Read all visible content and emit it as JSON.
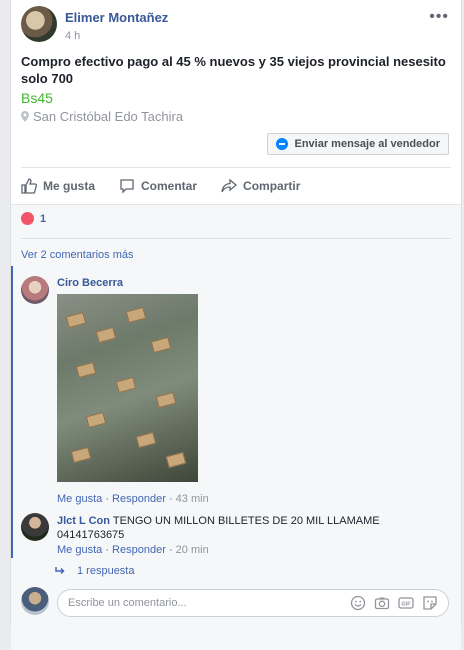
{
  "post": {
    "author": "Elimer Montañez",
    "time": "4 h",
    "more_label": "•••",
    "text": "Compro efectivo pago al 45 % nuevos y 35 viejos provincial nesesito solo 700",
    "price": "Bs45",
    "location": "San Cristóbal Edo Tachira",
    "message_button": "Enviar mensaje al vendedor"
  },
  "actions": {
    "like": "Me gusta",
    "comment": "Comentar",
    "share": "Compartir"
  },
  "reactions": {
    "count": "1"
  },
  "comments": {
    "view_more": "Ver 2 comentarios más",
    "items": [
      {
        "author": "Ciro Becerra",
        "like": "Me gusta",
        "sep": "·",
        "reply": "Responder",
        "time": "43 min"
      },
      {
        "author": "Jlct L Con",
        "text": "TENGO UN MILLON BILLETES DE 20 MIL LLAMAME 04141763675",
        "like": "Me gusta",
        "sep": "·",
        "reply": "Responder",
        "time": "20 min"
      }
    ],
    "replies": "1 respuesta"
  },
  "composer": {
    "placeholder": "Escribe un comentario..."
  },
  "colors": {
    "link": "#385898",
    "accent": "#4267b2",
    "price": "#42b72a",
    "angry": "#f35369"
  }
}
